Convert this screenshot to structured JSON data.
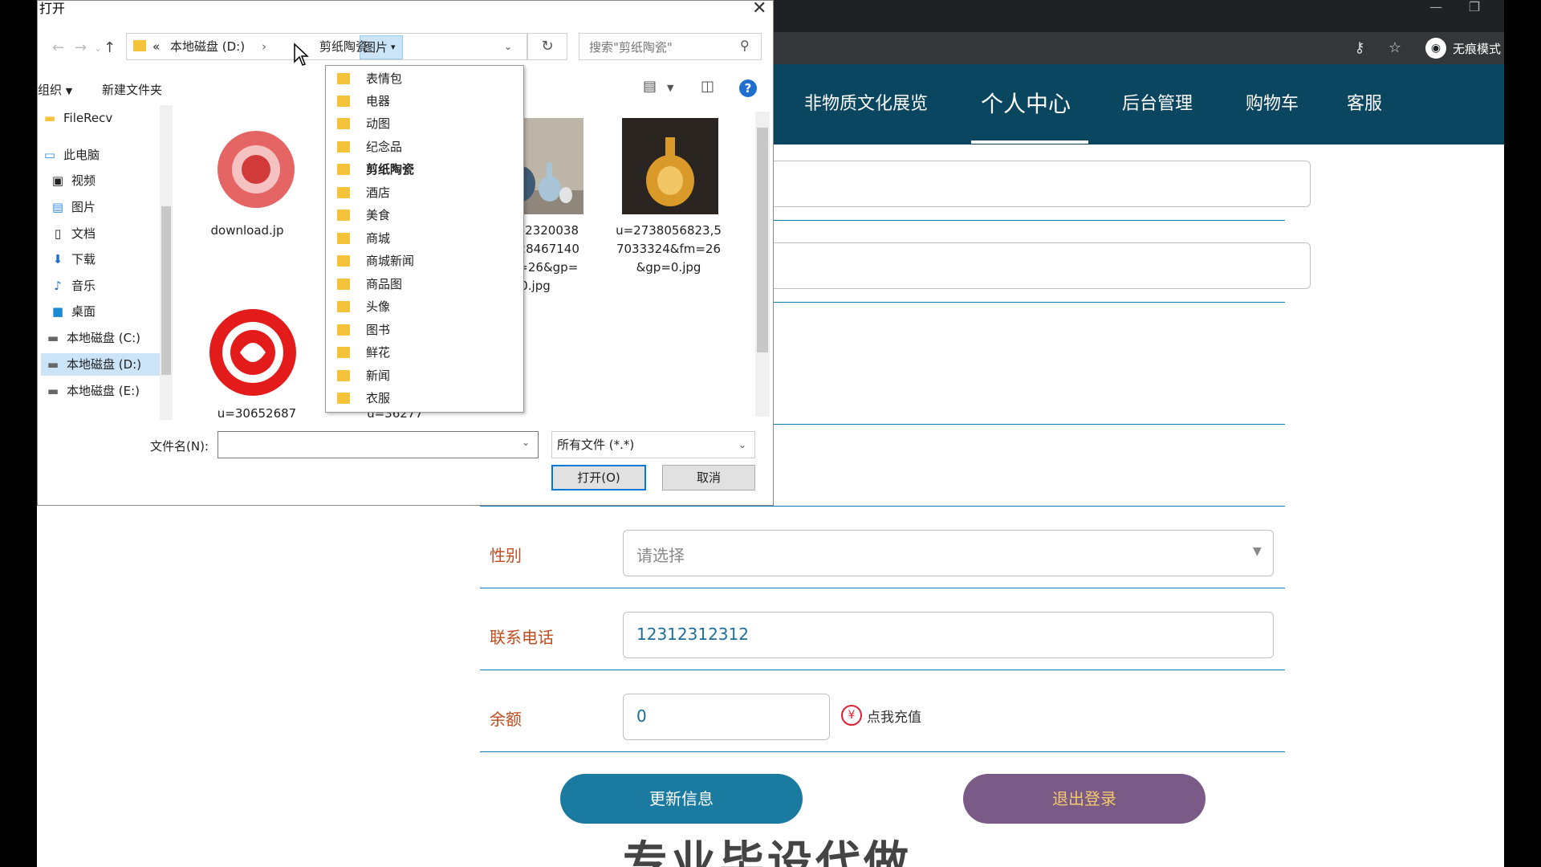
{
  "browser": {
    "incognito_label": "无痕模式",
    "nav_items": [
      "非物质文化展览",
      "个人中心",
      "后台管理",
      "购物车",
      "客服"
    ],
    "active_nav": "个人中心"
  },
  "profile_form": {
    "gender": {
      "label": "性别",
      "placeholder": "请选择"
    },
    "phone": {
      "label": "联系电话",
      "value": "12312312312"
    },
    "balance": {
      "label": "余额",
      "value": "0",
      "recharge_label": "点我充值"
    },
    "update_button": "更新信息",
    "logout_button": "退出登录",
    "footer_text": "专业毕设代做"
  },
  "file_dialog": {
    "title": "打开",
    "address": {
      "prefix": "«",
      "drive": "本地磁盘 (D:)",
      "folder": "图片",
      "subfolder": "剪纸陶瓷"
    },
    "search_placeholder": "搜索\"剪纸陶瓷\"",
    "organize": "组织",
    "new_folder": "新建文件夹",
    "nav_pane": [
      {
        "label": "FileRecv",
        "icon": "folder-icon"
      },
      {
        "label": "此电脑",
        "icon": "computer-icon"
      },
      {
        "label": "视频",
        "icon": "video-icon"
      },
      {
        "label": "图片",
        "icon": "pictures-icon"
      },
      {
        "label": "文档",
        "icon": "documents-icon"
      },
      {
        "label": "下载",
        "icon": "download-icon"
      },
      {
        "label": "音乐",
        "icon": "music-icon"
      },
      {
        "label": "桌面",
        "icon": "desktop-icon"
      },
      {
        "label": "本地磁盘 (C:)",
        "icon": "drive-icon"
      },
      {
        "label": "本地磁盘 (D:)",
        "icon": "drive-icon"
      },
      {
        "label": "本地磁盘 (E:)",
        "icon": "drive-icon"
      }
    ],
    "files": [
      {
        "name": "download.jp"
      },
      {
        "name": "u=2623200383,1628467140&fm=26&gp=0.jpg"
      },
      {
        "name": "u=2738056823,57033324&fm=26&gp=0.jpg"
      },
      {
        "name": "u=30652687"
      },
      {
        "name": "u=36277"
      }
    ],
    "folder_dropdown": [
      "表情包",
      "电器",
      "动图",
      "纪念品",
      "剪纸陶瓷",
      "酒店",
      "美食",
      "商城",
      "商城新闻",
      "商品图",
      "头像",
      "图书",
      "鲜花",
      "新闻",
      "衣服"
    ],
    "current_folder": "剪纸陶瓷",
    "filename_label": "文件名(N):",
    "filename_value": "",
    "filetype": "所有文件 (*.*)",
    "open_button": "打开(O)",
    "cancel_button": "取消"
  }
}
